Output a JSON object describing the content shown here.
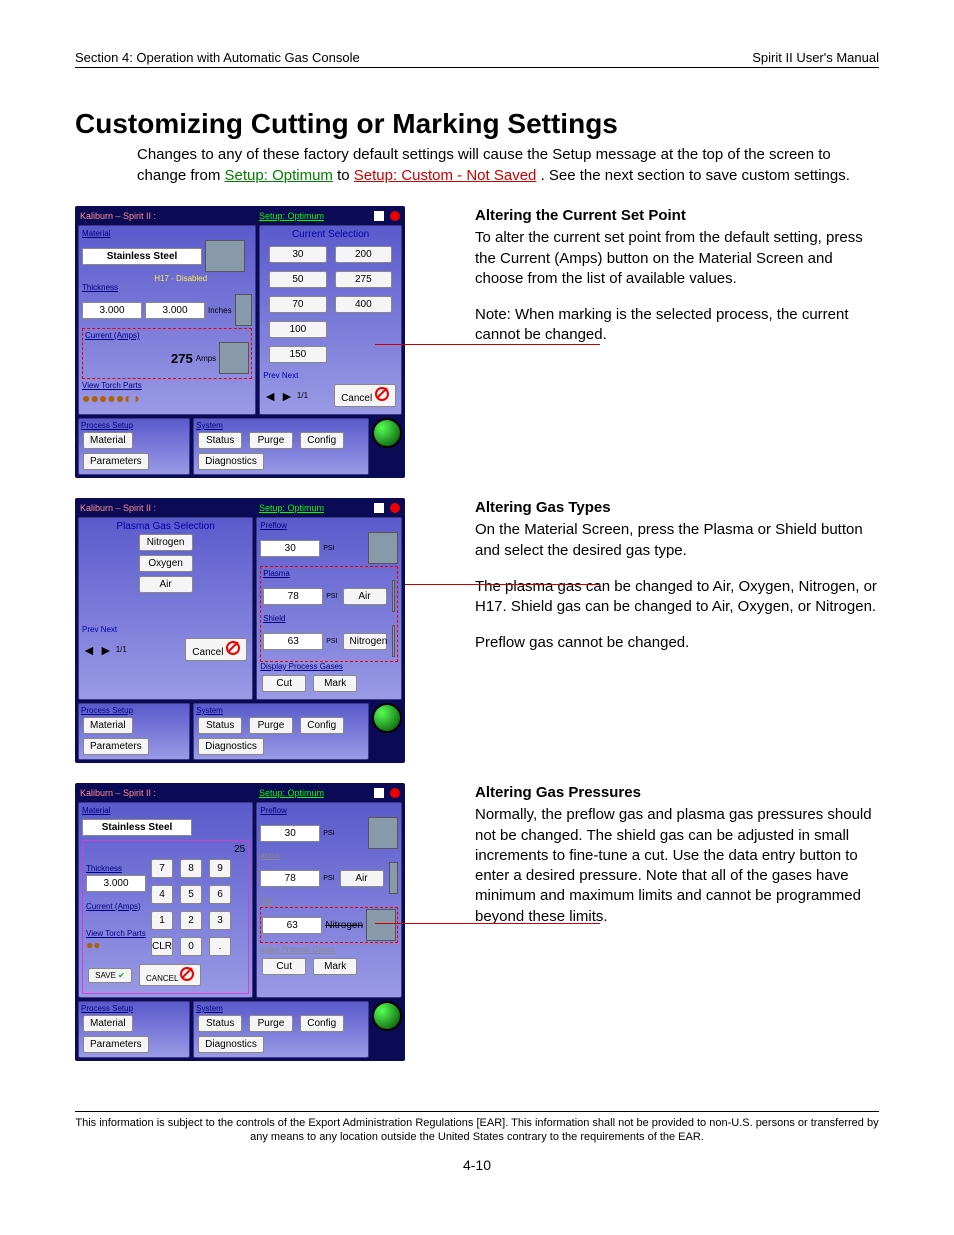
{
  "header": {
    "left": "Section 4: Operation with Automatic Gas Console",
    "right": "Spirit II User's Manual"
  },
  "title": "Customizing Cutting or Marking Settings",
  "intro": {
    "pre": "Changes to any of these factory default settings will cause the Setup message at the top of the screen to change from ",
    "link1": "Setup: Optimum",
    "mid": " to ",
    "link2": "Setup: Custom - Not Saved",
    "post": ".  See the next section to save custom settings."
  },
  "hmi_common": {
    "app": "Kaliburn – Spirit II :",
    "setup": "Setup: Optimum",
    "tabs_left": "Process Setup",
    "tabs_right": "System",
    "btn_material": "Material",
    "btn_parameters": "Parameters",
    "btn_status": "Status",
    "btn_purge": "Purge",
    "btn_config": "Config",
    "btn_diag": "Diagnostics",
    "prev": "Prev",
    "next": "Next",
    "pager": "1/1",
    "cancel": "Cancel",
    "save": "SAVE",
    "cancel2": "CANCEL",
    "clr": "CLR"
  },
  "hmi1": {
    "material_label": "Material",
    "material": "Stainless Steel",
    "material_sub": "H17 - Disabled",
    "thickness_label": "Thickness",
    "thickness_a": "3.000",
    "thickness_b": "3.000",
    "thick_unit": "Inches",
    "current_label": "Current (Amps)",
    "current": "275",
    "current_unit": "Amps",
    "parts_label": "View Torch Parts",
    "curr_sel": "Current Selection",
    "opts": [
      "30",
      "200",
      "50",
      "275",
      "70",
      "400",
      "100",
      "150"
    ]
  },
  "hmi2": {
    "title_left": "Plasma Gas Selection",
    "opts": [
      "Nitrogen",
      "Oxygen",
      "Air"
    ],
    "preflow_label": "Preflow",
    "preflow_val": "30",
    "psi": "PSI",
    "plasma_label": "Plasma",
    "plasma_val": "78",
    "plasma_gas": "Air",
    "shield_label": "Shield",
    "shield_val": "63",
    "shield_gas": "Nitrogen",
    "disp": "Display Process Gases",
    "cut": "Cut",
    "mark": "Mark"
  },
  "hmi3": {
    "material": "Stainless Steel",
    "val25": "25",
    "thickness": "3.000",
    "keypad": [
      "7",
      "8",
      "9",
      "4",
      "5",
      "6",
      "1",
      "2",
      "3"
    ],
    "zero": "0",
    "dot": ".",
    "shield_val": "63",
    "shield_gas": "Nitrogen"
  },
  "s1": {
    "h": "Altering the Current Set Point",
    "p1": "To alter the current set point from the default setting, press the Current (Amps) button on the Material Screen and choose from the list of available values.",
    "p2": "Note: When marking is the selected process, the current cannot be changed."
  },
  "s2": {
    "h": "Altering Gas Types",
    "p1": "On the Material Screen, press the Plasma or Shield button and select the desired gas type.",
    "p2": "The plasma gas can be changed to Air, Oxygen, Nitrogen, or H17.  Shield gas can be changed to Air, Oxygen, or Nitrogen.",
    "p3": "Preflow gas cannot be changed."
  },
  "s3": {
    "h": "Altering Gas Pressures",
    "p1": "Normally, the preflow gas and plasma gas pressures should not be changed.  The shield gas can be adjusted in small increments to fine-tune a cut.  Use the data entry button to enter a desired pressure.  Note that all of the gases have minimum and maximum limits and cannot be programmed beyond these limits."
  },
  "footer": "This information is subject to the controls of the Export Administration Regulations [EAR].  This information shall not be provided to non-U.S. persons or transferred by any means to any location outside the United States contrary to the requirements of the EAR.",
  "page": "4-10"
}
